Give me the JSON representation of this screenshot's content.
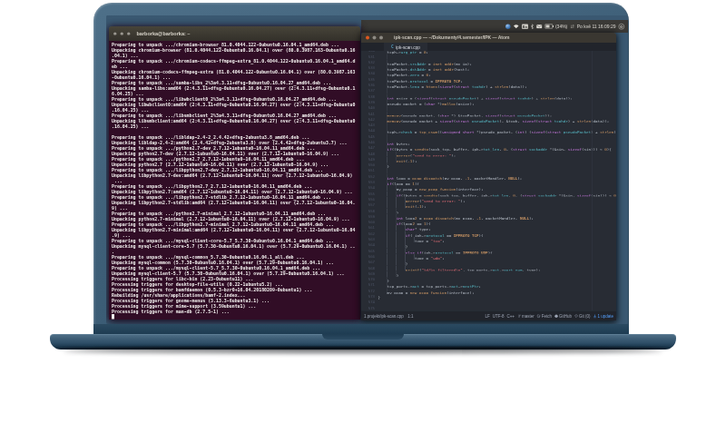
{
  "panel": {
    "keyboard_indicator": "En",
    "battery_percent": "(34%)",
    "clock": "Po kvě 11 16:09:29"
  },
  "terminal": {
    "title": "barborka@barborka: ~",
    "lines": [
      "Preparing to unpack .../chromium-browser_81.0.4044.122-0ubuntu0.16.04.1_amd64.deb ...",
      "Unpacking chromium-browser (81.0.4044.122-0ubuntu0.16.04.1) over (80.0.3987.163-0ubuntu0.16",
      ".04.1) ...",
      "Preparing to unpack .../chromium-codecs-ffmpeg-extra_81.0.4044.122-0ubuntu0.16.04.1_amd64.d",
      "eb ...",
      "Unpacking chromium-codecs-ffmpeg-extra (81.0.4044.122-0ubuntu0.16.04.1) over (80.0.3987.163",
      "-0ubuntu0.16.04.1) ...",
      "Preparing to unpack .../samba-libs_2%3a4.3.11+dfsg-0ubuntu0.16.04.27_amd64.deb ...",
      "Unpacking samba-libs:amd64 (2:4.3.11+dfsg-0ubuntu0.16.04.27) over (2:4.3.11+dfsg-0ubuntu0.1",
      "6.04.25) ...",
      "Preparing to unpack .../libwbclient0_2%3a4.3.11+dfsg-0ubuntu0.16.04.27_amd64.deb ...",
      "Unpacking libwbclient0:amd64 (2:4.3.11+dfsg-0ubuntu0.16.04.27) over (2:4.3.11+dfsg-0ubuntu0",
      ".16.04.25) ...",
      "Preparing to unpack .../libsmbclient_2%3a4.3.11+dfsg-0ubuntu0.16.04.27_amd64.deb ...",
      "Unpacking libsmbclient:amd64 (2:4.3.11+dfsg-0ubuntu0.16.04.27) over (2:4.3.11+dfsg-0ubuntu0",
      ".16.04.25) ...",
      "",
      "Preparing to unpack .../libldap-2.4-2_2.4.42+dfsg-2ubuntu3.8_amd64.deb ...",
      "Unpacking libldap-2.4-2:amd64 (2.4.42+dfsg-2ubuntu3.8) over (2.4.42+dfsg-2ubuntu3.7) ...",
      "Preparing to unpack .../python2.7-dev_2.7.12-1ubuntu0~16.04.11_amd64.deb ...",
      "Unpacking python2.7-dev (2.7.12-1ubuntu0~16.04.11) over (2.7.12-1ubuntu0~16.04.9) ...",
      "Preparing to unpack .../python2.7_2.7.12-1ubuntu0~16.04.11_amd64.deb ...",
      "Unpacking python2.7 (2.7.12-1ubuntu0~16.04.11) over (2.7.12-1ubuntu0~16.04.9) ...",
      "Preparing to unpack .../libpython2.7-dev_2.7.12-1ubuntu0~16.04.11_amd64.deb ...",
      "Unpacking libpython2.7-dev:amd64 (2.7.12-1ubuntu0~16.04.11) over (2.7.12-1ubuntu0~16.04.9)",
      " ...",
      "Preparing to unpack .../libpython2.7_2.7.12-1ubuntu0~16.04.11_amd64.deb ...",
      "Unpacking libpython2.7:amd64 (2.7.12-1ubuntu0~16.04.11) over (2.7.12-1ubuntu0~16.04.9) ...",
      "Preparing to unpack .../libpython2.7-stdlib_2.7.12-1ubuntu0~16.04.11_amd64.deb ...",
      "Unpacking libpython2.7-stdlib:amd64 (2.7.12-1ubuntu0~16.04.11) over (2.7.12-1ubuntu0~16.04.",
      "9) ...",
      "Preparing to unpack .../python2.7-minimal_2.7.12-1ubuntu0~16.04.11_amd64.deb ...",
      "Unpacking python2.7-minimal (2.7.12-1ubuntu0~16.04.11) over (2.7.12-1ubuntu0~16.04.9) ...",
      "Preparing to unpack .../libpython2.7-minimal_2.7.12-1ubuntu0~16.04.11_amd64.deb ...",
      "Unpacking libpython2.7-minimal:amd64 (2.7.12-1ubuntu0~16.04.11) over (2.7.12-1ubuntu0~16.04",
      ".9) ...",
      "Preparing to unpack .../mysql-client-core-5.7_5.7.30-0ubuntu0.16.04.1_amd64.deb ...",
      "Unpacking mysql-client-core-5.7 (5.7.30-0ubuntu0.16.04.1) over (5.7.29-0ubuntu0.16.04.1) ..",
      ".",
      "Preparing to unpack .../mysql-common_5.7.30-0ubuntu0.16.04.1_all.deb ...",
      "Unpacking mysql-common (5.7.30-0ubuntu0.16.04.1) over (5.7.29-0ubuntu0.16.04.1) ...",
      "Preparing to unpack .../mysql-client-5.7_5.7.30-0ubuntu0.16.04.1_amd64.deb ...",
      "Unpacking mysql-client-5.7 (5.7.30-0ubuntu0.16.04.1) over (5.7.29-0ubuntu0.16.04.1) ...",
      "Processing triggers for libc-bin (2.23-0ubuntu11) ...",
      "Processing triggers for desktop-file-utils (0.22-1ubuntu5.2) ...",
      "Processing triggers for bamfdaemon (0.5.3-bzr0+16.04.20180209-0ubuntu1) ...",
      "Rebuilding /usr/share/applications/bamf-2.index...",
      "Processing triggers for gnome-menus (3.13.3-6ubuntu3.1) ...",
      "Processing triggers for mime-support (3.59ubuntu1) ...",
      "Processing triggers for man-db (2.7.5-1) ..."
    ]
  },
  "editor": {
    "window_title": "ipk-scan.cpp — ~/Dokumenty/4.semester/IPK — Atom",
    "tab_label": "ipk-scan.cpp",
    "tab_icon": "C",
    "first_line_number": 530,
    "code_lines": [
      "    tcph->urg_ptr = 0;",
      "",
      "    tcpPacket.srcAddr = inet_addr(my_ip);",
      "    tcpPacket.dstAddr = inet_addr(host);",
      "    tcpPacket.zero = 0;",
      "    tcpPacket.protocol = IPPROTO_TCP;",
      "    tcpPacket.leng = htons(sizeof(struct tcphdr) + strlen(data));",
      "",
      "    int psize = (sizeof(struct pseudoPacket) + sizeof(struct tcphdr) + strlen(data));",
      "    pseudo_packet = (char *)malloc(psize);",
      "",
      "    memcpy(pseudo_packet, (char *) &tcpPacket, sizeof(struct pseudoPacket));",
      "    memcpy(pseudo_packet + sizeof(struct pseudoPacket), &tcph, sizeof(struct tcphdr) + strlen(data));",
      "",
      "    tcph->check = tcp_csum((unsigned short *)pseudo_packet, (int) (sizeof(struct pseudoPacket) + strlen(data)));",
      "",
      "    int bytes;",
      "    if((bytes = sendto(sock_tcp, buffer, iph->tot_len, 0, (struct sockaddr *)&sin, sizeof(sin))) < 0){",
      "        perror(\"send to error: \");",
      "        exit(-1);",
      "    }",
      "",
      "    int loop = pcap_dispatch(my_pcap, -1, packetHandler, NULL);",
      "    if(loop == 1){",
      "        my_pcap = new_pcap_funcion(interface);",
      "        if((bytes = sendto(sock_tcp, buffer, iph->tot_len, 0, (struct sockaddr *)&sin, sizeof(sin))) < 0){",
      "            perror(\"send to error: \");",
      "            exit(-1);",
      "        }",
      "        int loop2 = pcap_dispatch(my_pcap, -1, packetHandler, NULL);",
      "        if(loop2 == 1){",
      "            char* type;",
      "            if( iph->protocol == IPPROTO_TCP){",
      "                type = \"tcp\";",
      "            }",
      "            else if(iph->protocol == IPPROTO_UDP){",
      "                type = \"udp\";",
      "            }",
      "            printf(\"%d/%s filtered\\n\", tcp_ports->act->port_num, type);",
      "        }",
      "    }",
      "    tcp_ports->act = tcp_ports->act->nextPtr;",
      "    my_pcap = new_pcap_funcion(interface);",
      "}",
      "",
      ""
    ],
    "status_left": {
      "path": "1.projekt/ipk-scan.cpp",
      "cursor_position": "1:1"
    },
    "status_right": [
      {
        "label": "LF",
        "icon": ""
      },
      {
        "label": "UTF-8",
        "icon": ""
      },
      {
        "label": "C++",
        "icon": ""
      },
      {
        "label": "master",
        "icon": "branch"
      },
      {
        "label": "Fetch",
        "icon": "fetch"
      },
      {
        "label": "GitHub",
        "icon": "github"
      },
      {
        "label": "Git (0)",
        "icon": "git"
      },
      {
        "label": "1 update",
        "icon": "download",
        "accent": true
      }
    ]
  }
}
